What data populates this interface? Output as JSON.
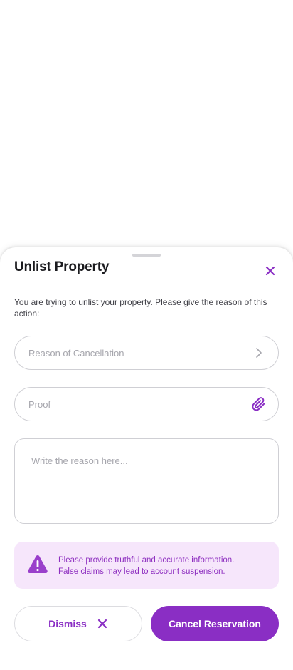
{
  "sheet": {
    "title": "Unlist Property",
    "description": "You are trying to unlist your property. Please give the reason of this action:",
    "close_icon": "close-icon"
  },
  "form": {
    "reason_placeholder": "Reason of Cancellation",
    "reason_trailing_icon": "chevron-right-icon",
    "proof_placeholder": "Proof",
    "proof_trailing_icon": "paperclip-icon",
    "details_placeholder": "Write the reason here..."
  },
  "warning": {
    "icon": "warning-triangle-icon",
    "line1": "Please provide truthful and accurate information.",
    "line2": "False claims may lead to account suspension."
  },
  "actions": {
    "dismiss_label": "Dismiss",
    "dismiss_icon": "close-icon",
    "cancel_label": "Cancel Reservation"
  },
  "colors": {
    "accent": "#8a2ec4",
    "warning_bg": "#f6e6fb",
    "warning_text": "#8e2fc0",
    "border": "#cfcfd4",
    "placeholder": "#a6a6ad"
  }
}
